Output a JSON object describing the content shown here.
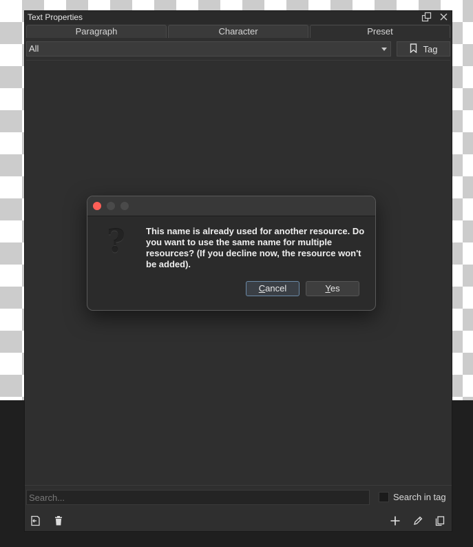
{
  "panel": {
    "title": "Text Properties",
    "tabs": [
      {
        "label": "Paragraph"
      },
      {
        "label": "Character"
      },
      {
        "label": "Preset"
      }
    ],
    "filter": {
      "selected": "All",
      "tag_label": "Tag"
    },
    "search": {
      "placeholder": "Search...",
      "search_in_tag_label": "Search in tag",
      "search_in_tag_checked": false
    }
  },
  "dialog": {
    "message": "This name is already used for another resource. Do you want to use the same name for multiple resources? (If you decline now, the resource won't be added).",
    "cancel_first": "C",
    "cancel_rest": "ancel",
    "yes_first": "Y",
    "yes_rest": "es",
    "traffic_colors": [
      "#ff5f57",
      "#4a4a4a",
      "#4a4a4a"
    ],
    "icon": "question-mark-icon"
  },
  "colors": {
    "panel_bg": "#2f2f2f",
    "default_button_border": "#6b8aa8"
  }
}
